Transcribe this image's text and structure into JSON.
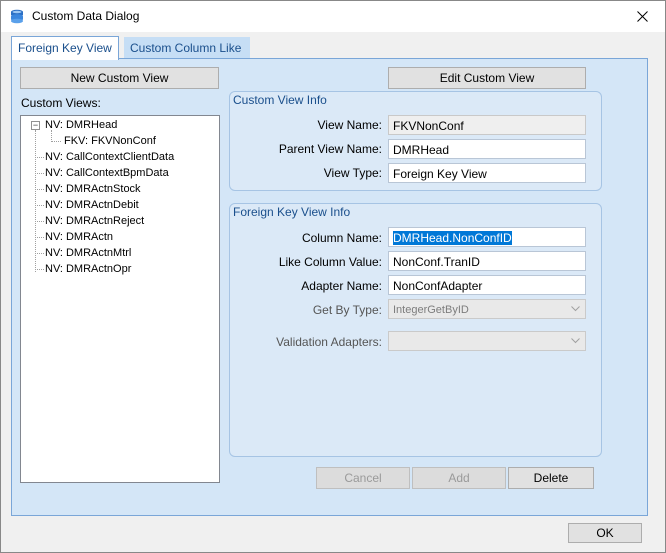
{
  "window": {
    "title": "Custom Data Dialog"
  },
  "tabs": [
    {
      "label": "Foreign Key View",
      "active": true
    },
    {
      "label": "Custom Column Like",
      "active": false
    }
  ],
  "left": {
    "new_button": "New Custom View",
    "list_label": "Custom Views:",
    "tree": [
      {
        "label": "NV: DMRHead",
        "expanded": true
      },
      {
        "label": "FKV: FKVNonConf",
        "child": true
      },
      {
        "label": "NV: CallContextClientData"
      },
      {
        "label": "NV: CallContextBpmData"
      },
      {
        "label": "NV: DMRActnStock"
      },
      {
        "label": "NV: DMRActnDebit"
      },
      {
        "label": "NV: DMRActnReject"
      },
      {
        "label": "NV: DMRActn"
      },
      {
        "label": "NV: DMRActnMtrl"
      },
      {
        "label": "NV: DMRActnOpr"
      }
    ]
  },
  "edit_button": "Edit Custom View",
  "custom_view_info": {
    "title": "Custom View Info",
    "view_name_label": "View Name:",
    "view_name_value": "FKVNonConf",
    "parent_view_label": "Parent View Name:",
    "parent_view_value": "DMRHead",
    "view_type_label": "View Type:",
    "view_type_value": "Foreign Key View"
  },
  "fk_view_info": {
    "title": "Foreign Key View Info",
    "column_name_label": "Column Name:",
    "column_name_value": "DMRHead.NonConfID",
    "like_column_label": "Like Column Value:",
    "like_column_value": "NonConf.TranID",
    "adapter_name_label": "Adapter Name:",
    "adapter_name_value": "NonConfAdapter",
    "get_by_type_label": "Get By Type:",
    "get_by_type_value": "IntegerGetByID",
    "validation_label": "Validation Adapters:",
    "validation_value": ""
  },
  "actions": {
    "cancel": "Cancel",
    "add": "Add",
    "delete": "Delete"
  },
  "ok_button": "OK",
  "icons": {
    "app": "app-icon",
    "close": "close-icon",
    "expand": "minus-expander-icon",
    "dropdown": "chevron-down-icon"
  }
}
